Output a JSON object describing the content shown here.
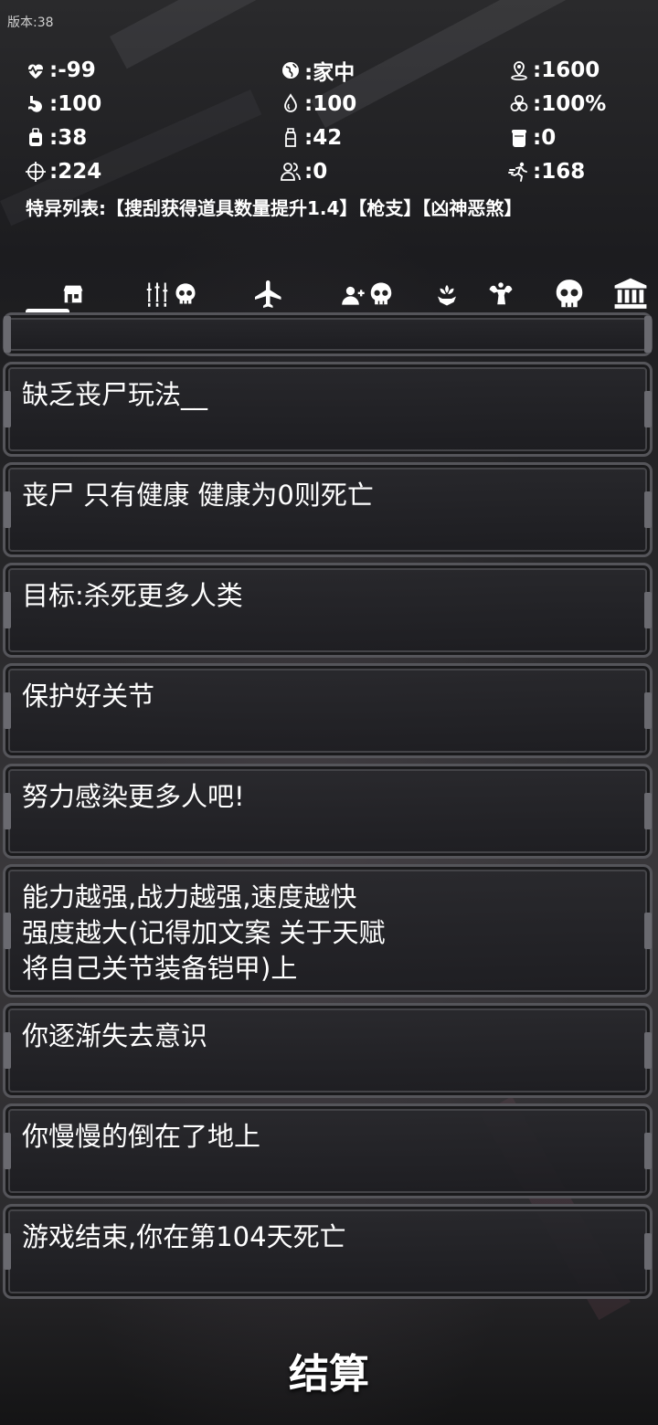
{
  "version": "版本:38",
  "stats": [
    [
      {
        "icon": "heart-pulse-icon",
        "value": ":-99"
      },
      {
        "icon": "globe-icon",
        "value": ":家中"
      },
      {
        "icon": "map-pin-icon",
        "value": ":1600"
      }
    ],
    [
      {
        "icon": "stomach-icon",
        "value": ":100"
      },
      {
        "icon": "water-drop-icon",
        "value": ":100"
      },
      {
        "icon": "biohazard-icon",
        "value": ":100%"
      }
    ],
    [
      {
        "icon": "backpack-icon",
        "value": ":38"
      },
      {
        "icon": "bottle-icon",
        "value": ":42"
      },
      {
        "icon": "drum-icon",
        "value": ":0"
      }
    ],
    [
      {
        "icon": "crosshair-icon",
        "value": ":224"
      },
      {
        "icon": "people-icon",
        "value": ":0"
      },
      {
        "icon": "running-icon",
        "value": ":168"
      }
    ]
  ],
  "special_list": "特异列表:【搜刮获得道具数量提升1.4】【枪支】【凶神恶煞】",
  "tabs": [
    {
      "name": "shop-tab"
    },
    {
      "name": "weapons-skull-tab"
    },
    {
      "name": "airplane-tab"
    },
    {
      "name": "recruit-skull-tab"
    },
    {
      "name": "plant-tab"
    },
    {
      "name": "strength-tab"
    },
    {
      "name": "skull-tab"
    },
    {
      "name": "bank-tab"
    }
  ],
  "log": [
    "缺乏丧尸玩法__",
    "丧尸 只有健康 健康为0则死亡",
    "目标:杀死更多人类",
    "保护好关节",
    "努力感染更多人吧!",
    "能力越强,战力越强,速度越快\n强度越大(记得加文案 关于天赋\n将自己关节装备铠甲)上",
    "你逐渐失去意识",
    "你慢慢的倒在了地上",
    "游戏结束,你在第104天死亡"
  ],
  "settle_button": "结算"
}
